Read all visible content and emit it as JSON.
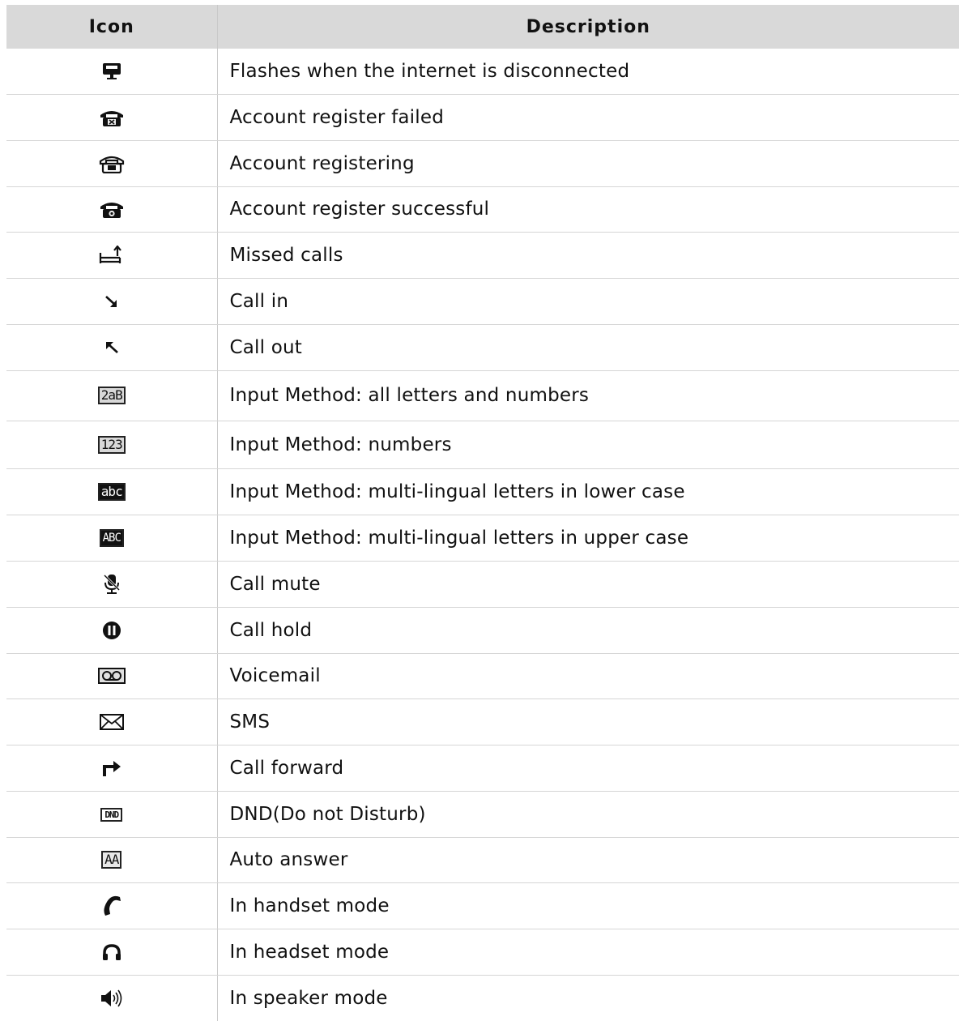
{
  "header": {
    "icon": "Icon",
    "description": "Description"
  },
  "rows": [
    {
      "icon": "network-disconnected-icon",
      "description": "Flashes when the internet is disconnected"
    },
    {
      "icon": "phone-register-failed-icon",
      "description": "Account register failed"
    },
    {
      "icon": "phone-registering-icon",
      "description": "Account registering"
    },
    {
      "icon": "phone-register-success-icon",
      "description": "Account register successful"
    },
    {
      "icon": "missed-calls-icon",
      "description": "Missed calls"
    },
    {
      "icon": "call-in-arrow-icon",
      "description": "Call in"
    },
    {
      "icon": "call-out-arrow-icon",
      "description": "Call out"
    },
    {
      "icon": "input-2ab-icon",
      "icon_text": "2aB",
      "description": "Input Method: all letters and numbers"
    },
    {
      "icon": "input-123-icon",
      "icon_text": "123",
      "description": "Input Method: numbers"
    },
    {
      "icon": "input-abc-lower-icon",
      "icon_text": "abc",
      "description": "Input Method: multi-lingual letters in lower case"
    },
    {
      "icon": "input-abc-upper-icon",
      "icon_text": "ABC",
      "description": "Input Method: multi-lingual letters in upper case"
    },
    {
      "icon": "microphone-mute-icon",
      "description": "Call mute"
    },
    {
      "icon": "call-hold-icon",
      "description": "Call hold"
    },
    {
      "icon": "voicemail-icon",
      "description": "Voicemail"
    },
    {
      "icon": "envelope-icon",
      "description": "SMS"
    },
    {
      "icon": "call-forward-icon",
      "description": "Call forward"
    },
    {
      "icon": "dnd-icon",
      "icon_text": "DND",
      "description": "DND(Do not Disturb)"
    },
    {
      "icon": "auto-answer-icon",
      "icon_text": "AA",
      "description": "Auto answer"
    },
    {
      "icon": "handset-icon",
      "description": "In handset mode"
    },
    {
      "icon": "headset-icon",
      "description": "In headset mode"
    },
    {
      "icon": "speaker-icon",
      "description": "In speaker mode"
    }
  ]
}
